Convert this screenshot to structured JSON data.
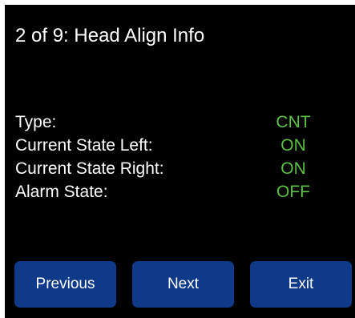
{
  "header": {
    "title": "2 of 9: Head Align Info"
  },
  "info": {
    "rows": [
      {
        "label": "Type:",
        "value": "CNT"
      },
      {
        "label": "Current State Left:",
        "value": "ON"
      },
      {
        "label": "Current State Right:",
        "value": "ON"
      },
      {
        "label": "Alarm State:",
        "value": "OFF"
      }
    ]
  },
  "buttons": {
    "previous": "Previous",
    "next": "Next",
    "exit": "Exit"
  },
  "colors": {
    "background": "#000000",
    "text": "#ffffff",
    "value": "#5cc142",
    "button": "#0f3a8a"
  }
}
